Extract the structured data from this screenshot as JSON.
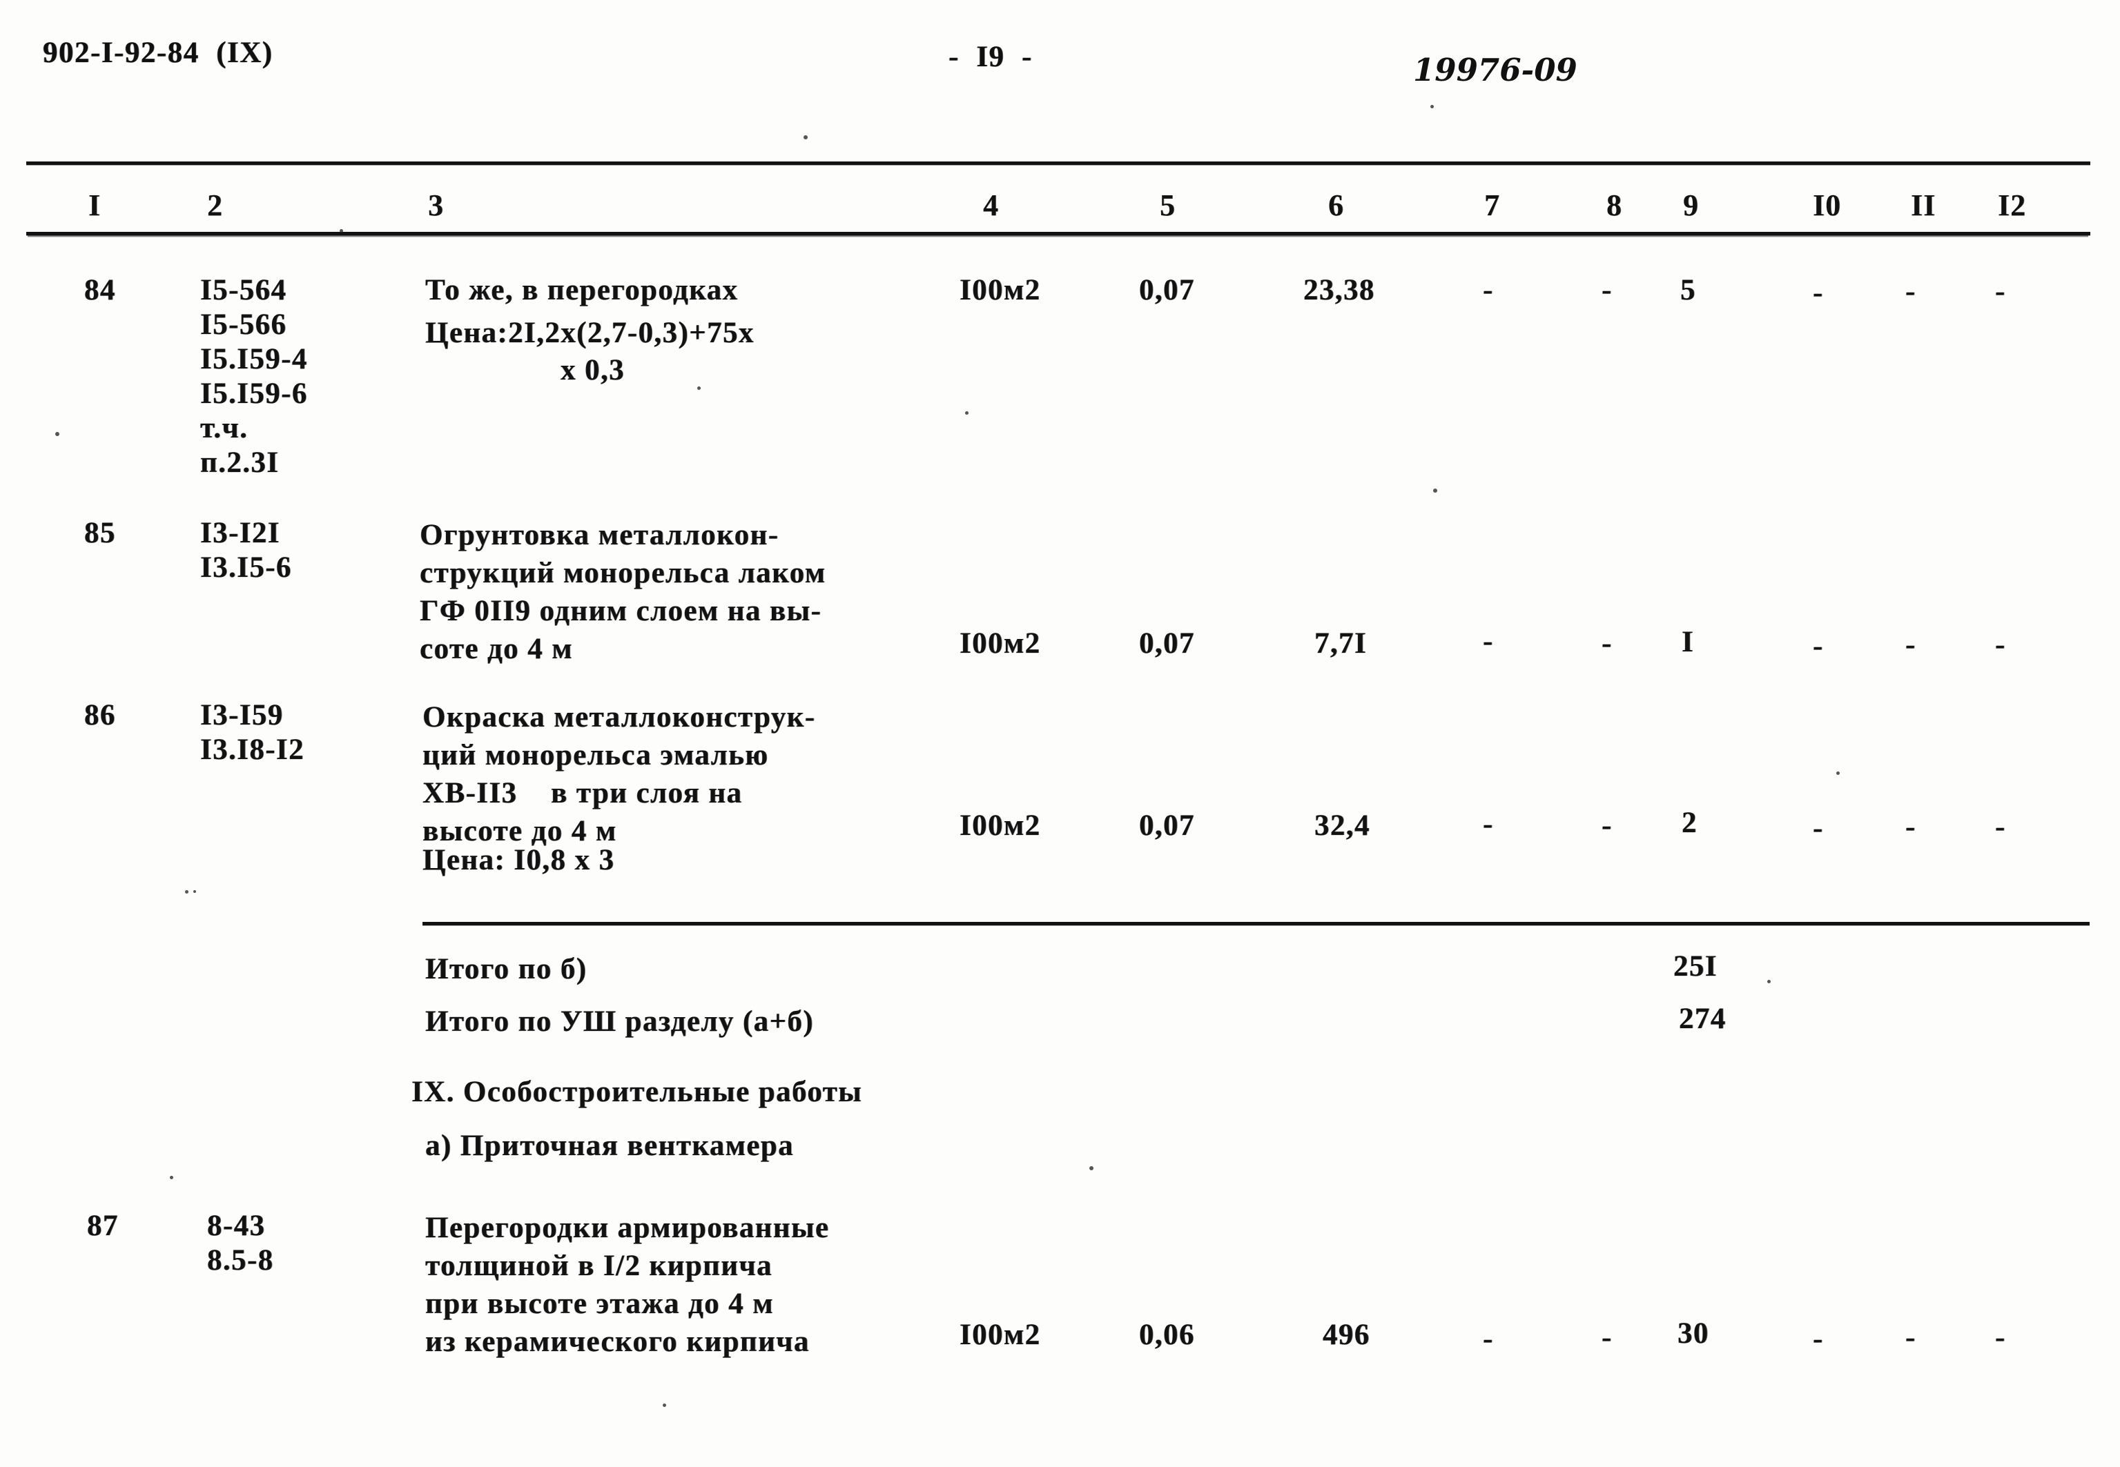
{
  "header": {
    "doc_code": "902-I-92-84  (IX)",
    "page_number": "-  I9  -",
    "right_code": "19976-09"
  },
  "table": {
    "column_headers": [
      "I",
      "2",
      "3",
      "4",
      "5",
      "6",
      "7",
      "8",
      "9",
      "I0",
      "II",
      "I2"
    ],
    "rows": [
      {
        "num": "84",
        "codes": "I5-564\nI5-566\nI5.I59-4\nI5.I59-6\nт.ч.\nп.2.3I",
        "description_line1": "То же, в перегородках",
        "description_line2": "Цена:2I,2х(2,7-0,3)+75х",
        "description_line3": "х 0,3",
        "unit": "I00м2",
        "c5": "0,07",
        "c6": "23,38",
        "c7": "-",
        "c8": "-",
        "c9": "5",
        "c10": "-",
        "c11": "-",
        "c12": "-"
      },
      {
        "num": "85",
        "codes": "I3-I2I\nI3.I5-6",
        "description": "Огрунтовка металлокон-\nструкций монорельса лаком\nГФ 0II9 одним слоем на вы-\nсоте до 4 м",
        "unit": "I00м2",
        "c5": "0,07",
        "c6": "7,7I",
        "c7": "-",
        "c8": "-",
        "c9": "I",
        "c10": "-",
        "c11": "-",
        "c12": "-"
      },
      {
        "num": "86",
        "codes": "I3-I59\nI3.I8-I2",
        "description": "Окраска металлоконструк-\nций монорельса эмалью\nХВ-II3    в три слоя на\nвысоте до 4 м",
        "description_extra": "Цена: I0,8 х 3",
        "unit": "I00м2",
        "c5": "0,07",
        "c6": "32,4",
        "c7": "-",
        "c8": "-",
        "c9": "2",
        "c10": "-",
        "c11": "-",
        "c12": "-"
      }
    ],
    "totals": [
      {
        "label": "Итого по б)",
        "value": "25I"
      },
      {
        "label": "Итого по УШ разделу (а+б)",
        "value": "274"
      }
    ],
    "section_heading": "IX. Особостроительные работы",
    "subsection_heading": "а) Приточная венткамера",
    "rows_after_heading": [
      {
        "num": "87",
        "codes": "8-43\n8.5-8",
        "description": "Перегородки армированные\nтолщиной в I/2 кирпича\nпри высоте этажа до 4 м\nиз керамического кирпича",
        "unit": "I00м2",
        "c5": "0,06",
        "c6": "496",
        "c7": "-",
        "c8": "-",
        "c9": "30",
        "c10": "-",
        "c11": "-",
        "c12": "-"
      }
    ]
  }
}
